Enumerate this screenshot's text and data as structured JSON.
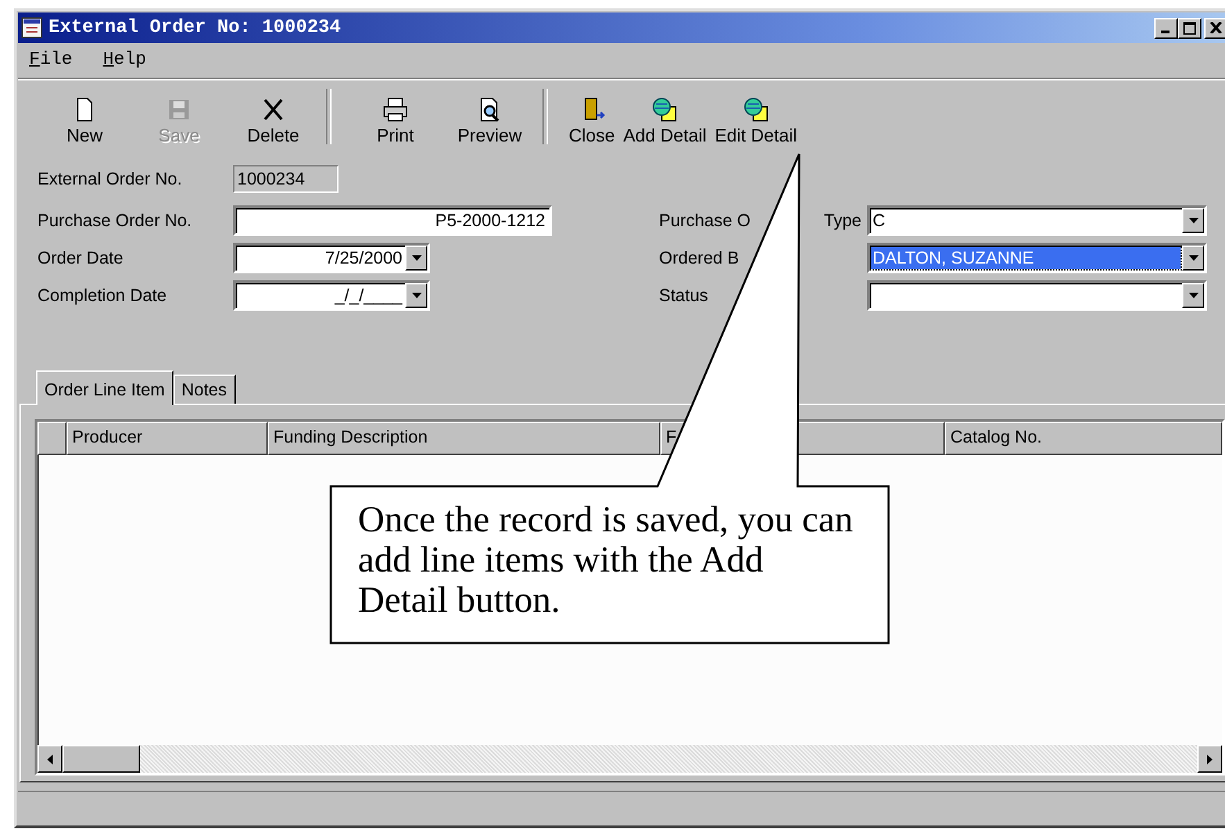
{
  "window": {
    "title": "External Order No: 1000234"
  },
  "menu": [
    {
      "label": "File"
    },
    {
      "label": "Help"
    }
  ],
  "toolbar": [
    {
      "label": "New",
      "kind": "new",
      "disabled": false,
      "separator_after": false
    },
    {
      "label": "Save",
      "kind": "save",
      "disabled": true,
      "separator_after": false
    },
    {
      "label": "Delete",
      "kind": "delete",
      "disabled": false,
      "separator_after": true
    },
    {
      "label": "Print",
      "kind": "print",
      "disabled": false,
      "separator_after": false
    },
    {
      "label": "Preview",
      "kind": "preview",
      "disabled": false,
      "separator_after": true
    },
    {
      "label": "Close",
      "kind": "close",
      "disabled": false,
      "separator_after": false
    },
    {
      "label": "Add Detail",
      "kind": "detail",
      "disabled": false,
      "separator_after": false
    },
    {
      "label": "Edit Detail",
      "kind": "detail",
      "disabled": false,
      "separator_after": false
    }
  ],
  "header_field": {
    "label": "External Order No.",
    "value": "1000234"
  },
  "left_fields": [
    {
      "label": "Purchase Order No.",
      "value": "P5-2000-1212",
      "kind": "text"
    },
    {
      "label": "Order Date",
      "value": "7/25/2000",
      "kind": "date"
    },
    {
      "label": "Completion Date",
      "value": "_/_/____",
      "kind": "date"
    }
  ],
  "right_fields": [
    {
      "label": "Purchase O",
      "label_tail": "Type",
      "value": "C",
      "highlighted": false
    },
    {
      "label": "Ordered B",
      "value": "DALTON, SUZANNE",
      "highlighted": true
    },
    {
      "label": "Status",
      "highlighted": false
    }
  ],
  "tabs": [
    {
      "label": "Order Line Item",
      "selected": true
    },
    {
      "label": "Notes",
      "selected": false
    }
  ],
  "grid": {
    "columns": [
      "Producer",
      "Funding Description",
      "F",
      "Catalog No."
    ]
  },
  "callout": {
    "text": "Once the record is saved, you can add line items with the Add Detail button."
  }
}
